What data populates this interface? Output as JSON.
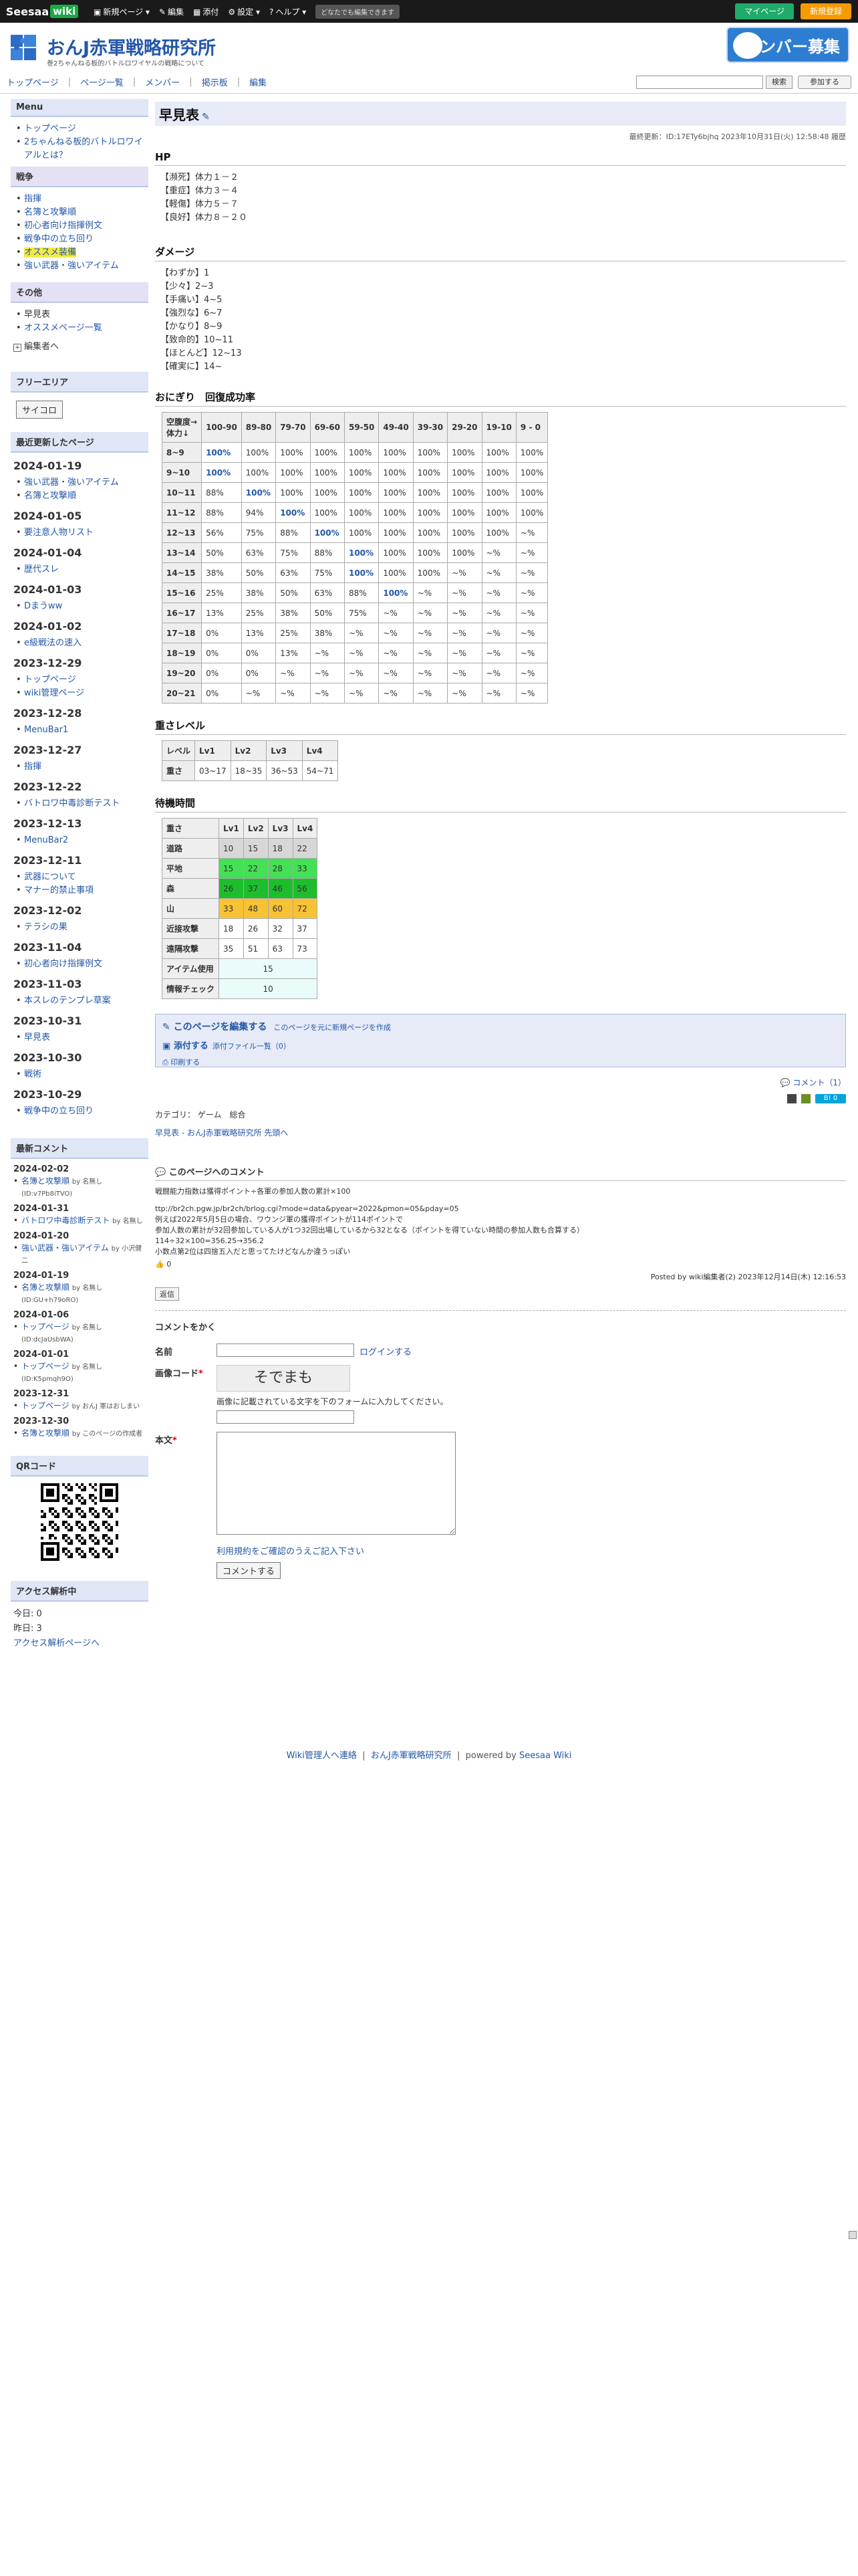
{
  "topbar": {
    "logo": "Seesaa",
    "logo2": "wiki",
    "menu": [
      {
        "icon": "▣",
        "label": "新規ページ ▾"
      },
      {
        "icon": "✎",
        "label": "編集"
      },
      {
        "icon": "▦",
        "label": "添付"
      },
      {
        "icon": "⚙",
        "label": "設定 ▾"
      },
      {
        "icon": "?",
        "label": "ヘルプ ▾"
      }
    ],
    "edit_note": "どなたでも編集できます",
    "mypage": "マイページ",
    "signup": "新規登録"
  },
  "header": {
    "title": "おんJ赤軍戦略研究所",
    "subtitle": "巻2ちゃんねる板的バトルロワイヤルの戦略について",
    "banner": "メンバー募集"
  },
  "nav": {
    "items": [
      "トップページ",
      "ページ一覧",
      "メンバー",
      "掲示板",
      "編集"
    ],
    "search_button": "検索",
    "join_button": "参加する"
  },
  "sidebar": {
    "menu_h": "Menu",
    "menu_items": [
      "トップページ",
      "2ちゃんねる板的バトルロワイアルとは？"
    ],
    "war_h": "戦争",
    "war_items": [
      "指揮",
      "名簿と攻撃順",
      "初心者向け指揮例文",
      "戦争中の立ち回り",
      "オススメ装備",
      "強い武器・強いアイテム"
    ],
    "other_h": "その他",
    "other_items": [
      "早見表",
      "オススメページ一覧"
    ],
    "edit_menu": "編集者へ",
    "free_h": "フリーエリア",
    "free_btn": "サイコロ",
    "recent_h": "最近更新したページ",
    "recent": [
      {
        "date": "2024-01-19",
        "pages": [
          "強い武器・強いアイテム",
          "名簿と攻撃順"
        ]
      },
      {
        "date": "2024-01-05",
        "pages": [
          "要注意人物リスト"
        ]
      },
      {
        "date": "2024-01-04",
        "pages": [
          "歴代スレ"
        ]
      },
      {
        "date": "2024-01-03",
        "pages": [
          "Dまうww"
        ]
      },
      {
        "date": "2024-01-02",
        "pages": [
          "e級戦法の速入"
        ]
      },
      {
        "date": "2023-12-29",
        "pages": [
          "トップページ",
          "wiki管理ページ"
        ]
      },
      {
        "date": "2023-12-28",
        "pages": [
          "MenuBar1"
        ]
      },
      {
        "date": "2023-12-27",
        "pages": [
          "指揮"
        ]
      },
      {
        "date": "2023-12-22",
        "pages": [
          "バトロワ中毒診断テスト"
        ]
      },
      {
        "date": "2023-12-13",
        "pages": [
          "MenuBar2"
        ]
      },
      {
        "date": "2023-12-11",
        "pages": [
          "武器について",
          "マナー的禁止事項"
        ]
      },
      {
        "date": "2023-12-02",
        "pages": [
          "テラシの果"
        ]
      },
      {
        "date": "2023-11-04",
        "pages": [
          "初心者向け指揮例文"
        ]
      },
      {
        "date": "2023-11-03",
        "pages": [
          "本スレのテンプレ草案"
        ]
      },
      {
        "date": "2023-10-31",
        "pages": [
          "早見表"
        ]
      },
      {
        "date": "2023-10-30",
        "pages": [
          "戦術"
        ]
      },
      {
        "date": "2023-10-29",
        "pages": [
          "戦争中の立ち回り"
        ]
      }
    ],
    "comments_h": "最新コメント",
    "comments": [
      {
        "date": "2024-02-02",
        "page": "名簿と攻撃順",
        "by": "by 名無し(ID:v7Pb8iTVO)"
      },
      {
        "date": "2024-01-31",
        "page": "バトロワ中毒診断テスト",
        "by": "by 名無し"
      },
      {
        "date": "2024-01-20",
        "page": "強い武器・強いアイテム",
        "by": "by 小沢健二"
      },
      {
        "date": "2024-01-19",
        "page": "名簿と攻撃順",
        "by": "by 名無し(ID:GU+h79oRO)"
      },
      {
        "date": "2024-01-06",
        "page": "トップページ",
        "by": "by 名無し(ID:dcJaUsbWA)"
      },
      {
        "date": "2024-01-01",
        "page": "トップページ",
        "by": "by 名無し(ID:K5pmqh9O)"
      },
      {
        "date": "2023-12-31",
        "page": "トップページ",
        "by": "by おんJ 軍はおしまい"
      },
      {
        "date": "2023-12-30",
        "page": "名簿と攻撃順",
        "by": "by このページの作成者"
      }
    ],
    "qr_h": "QRコード",
    "access_h": "アクセス解析中",
    "today": "今日: 0",
    "yesterday": "昨日: 3",
    "access_link": "アクセス解析ページへ"
  },
  "main": {
    "title": "早見表",
    "lastmod": "最終更新：ID:17ETy6bjhq 2023年10月31日(火) 12:58:48 履歴",
    "hp_h": "HP",
    "hp_lines": [
      "【瀕死】体力１－２",
      "【重症】体力３－４",
      "【軽傷】体力５－７",
      "【良好】体力８－２０"
    ],
    "dmg_h": "ダメージ",
    "dmg_lines": [
      "【わずか】1",
      "【少々】2~3",
      "【手痛い】4~5",
      "【強烈な】6~7",
      "【かなり】8~9",
      "【致命的】10~11",
      "【ほとんど】12~13",
      "【確実に】14~"
    ],
    "onigiri_h": "おにぎり　回復成功率",
    "onigiri_header": [
      "空腹度→\n体力↓",
      "100-90",
      "89-80",
      "79-70",
      "69-60",
      "59-50",
      "49-40",
      "39-30",
      "29-20",
      "19-10",
      "9 - 0"
    ],
    "onigiri_rows": [
      [
        "8~9",
        "100%",
        "100%",
        "100%",
        "100%",
        "100%",
        "100%",
        "100%",
        "100%",
        "100%",
        "100%"
      ],
      [
        "9~10",
        "100%",
        "100%",
        "100%",
        "100%",
        "100%",
        "100%",
        "100%",
        "100%",
        "100%",
        "100%"
      ],
      [
        "10~11",
        "88%",
        "100%",
        "100%",
        "100%",
        "100%",
        "100%",
        "100%",
        "100%",
        "100%",
        "100%"
      ],
      [
        "11~12",
        "88%",
        "94%",
        "100%",
        "100%",
        "100%",
        "100%",
        "100%",
        "100%",
        "100%",
        "100%"
      ],
      [
        "12~13",
        "56%",
        "75%",
        "88%",
        "100%",
        "100%",
        "100%",
        "100%",
        "100%",
        "100%",
        "~%"
      ],
      [
        "13~14",
        "50%",
        "63%",
        "75%",
        "88%",
        "100%",
        "100%",
        "100%",
        "100%",
        "~%",
        "~%"
      ],
      [
        "14~15",
        "38%",
        "50%",
        "63%",
        "75%",
        "100%",
        "100%",
        "100%",
        "~%",
        "~%",
        "~%"
      ],
      [
        "15~16",
        "25%",
        "38%",
        "50%",
        "63%",
        "88%",
        "100%",
        "~%",
        "~%",
        "~%",
        "~%"
      ],
      [
        "16~17",
        "13%",
        "25%",
        "38%",
        "50%",
        "75%",
        "~%",
        "~%",
        "~%",
        "~%",
        "~%"
      ],
      [
        "17~18",
        "0%",
        "13%",
        "25%",
        "38%",
        "~%",
        "~%",
        "~%",
        "~%",
        "~%",
        "~%"
      ],
      [
        "18~19",
        "0%",
        "0%",
        "13%",
        "~%",
        "~%",
        "~%",
        "~%",
        "~%",
        "~%",
        "~%"
      ],
      [
        "19~20",
        "0%",
        "0%",
        "~%",
        "~%",
        "~%",
        "~%",
        "~%",
        "~%",
        "~%",
        "~%"
      ],
      [
        "20~21",
        "0%",
        "~%",
        "~%",
        "~%",
        "~%",
        "~%",
        "~%",
        "~%",
        "~%",
        "~%"
      ]
    ],
    "onigiri_bold": [
      [
        0,
        1
      ],
      [
        1,
        1
      ],
      [
        2,
        2
      ],
      [
        3,
        3
      ],
      [
        4,
        4
      ],
      [
        5,
        5
      ],
      [
        6,
        5
      ],
      [
        7,
        6
      ]
    ],
    "weight_h": "重さレベル",
    "weight_header": [
      "レベル",
      "Lv1",
      "Lv2",
      "Lv3",
      "Lv4"
    ],
    "weight_row": [
      "重さ",
      "03~17",
      "18~35",
      "36~53",
      "54~71"
    ],
    "wait_h": "待機時間",
    "wait_header": [
      "重さ",
      "Lv1",
      "Lv2",
      "Lv3",
      "Lv4"
    ],
    "wait_rows": [
      {
        "label": "道路",
        "vals": [
          "10",
          "15",
          "18",
          "22"
        ],
        "cls": "bg-gray"
      },
      {
        "label": "平地",
        "vals": [
          "15",
          "22",
          "28",
          "33"
        ],
        "cls": "bg-lgreen"
      },
      {
        "label": "森",
        "vals": [
          "26",
          "37",
          "46",
          "56"
        ],
        "cls": "bg-dgreen"
      },
      {
        "label": "山",
        "vals": [
          "33",
          "48",
          "60",
          "72"
        ],
        "cls": "bg-orange"
      },
      {
        "label": "近接攻撃",
        "vals": [
          "18",
          "26",
          "32",
          "37"
        ],
        "cls": ""
      },
      {
        "label": "遠隔攻撃",
        "vals": [
          "35",
          "51",
          "63",
          "73"
        ],
        "cls": ""
      }
    ],
    "wait_item": {
      "label": "アイテム使用",
      "val": "15"
    },
    "wait_info": {
      "label": "情報チェック",
      "val": "10"
    },
    "edit_page": "このページを編集する",
    "edit_new": "このページを元に新規ページを作成",
    "attach": "添付する",
    "attach_list": "添付ファイル一覧（0）",
    "print": "印刷する",
    "comment_count": "コメント（1）",
    "hatena": "B! 0",
    "category": "カテゴリ： ゲーム　総合",
    "breadcrumb": "早見表 - おんJ赤軍戦略研究所 先頭へ",
    "comments_h": "このページへのコメント",
    "comment_lines": [
      "戦闘能力指数は獲得ポイント÷各軍の参加人数の累計×100",
      "",
      "ttp://br2ch.pgw.jp/br2ch/brlog.cgi?mode=data&pyear=2022&pmon=05&pday=05",
      "例えば2022年5月5日の場合、ワウンジ軍の獲得ポイントが114ポイントで",
      "参加人数の累計が32回参加している人が1つ32回出場しているから32となる（ポイントを得ていない時間の参加人数も合算する）",
      "114÷32×100=356.25→356.2",
      "小数点第2位は四捨五入だと思ってたけどなんか違うっぽい"
    ],
    "comment_score": "0",
    "comment_foot": "Posted by wiki編集者(2) 2023年12月14日(木) 12:16:53",
    "reply": "返信",
    "form_h": "コメントをかく",
    "name_label": "名前",
    "login": "ログインする",
    "captcha_label": "画像コード",
    "captcha_img": "そでまも",
    "captcha_note": "画像に記載されている文字を下のフォームに入力してください。",
    "body_label": "本文",
    "terms": "利用規約をご確認のうえご記入下さい",
    "submit": "コメントする"
  },
  "footer": {
    "admin": "Wiki管理人へ連絡",
    "site": "おんJ赤軍戦略研究所",
    "powered": "powered by",
    "seesaa": "Seesaa Wiki"
  }
}
